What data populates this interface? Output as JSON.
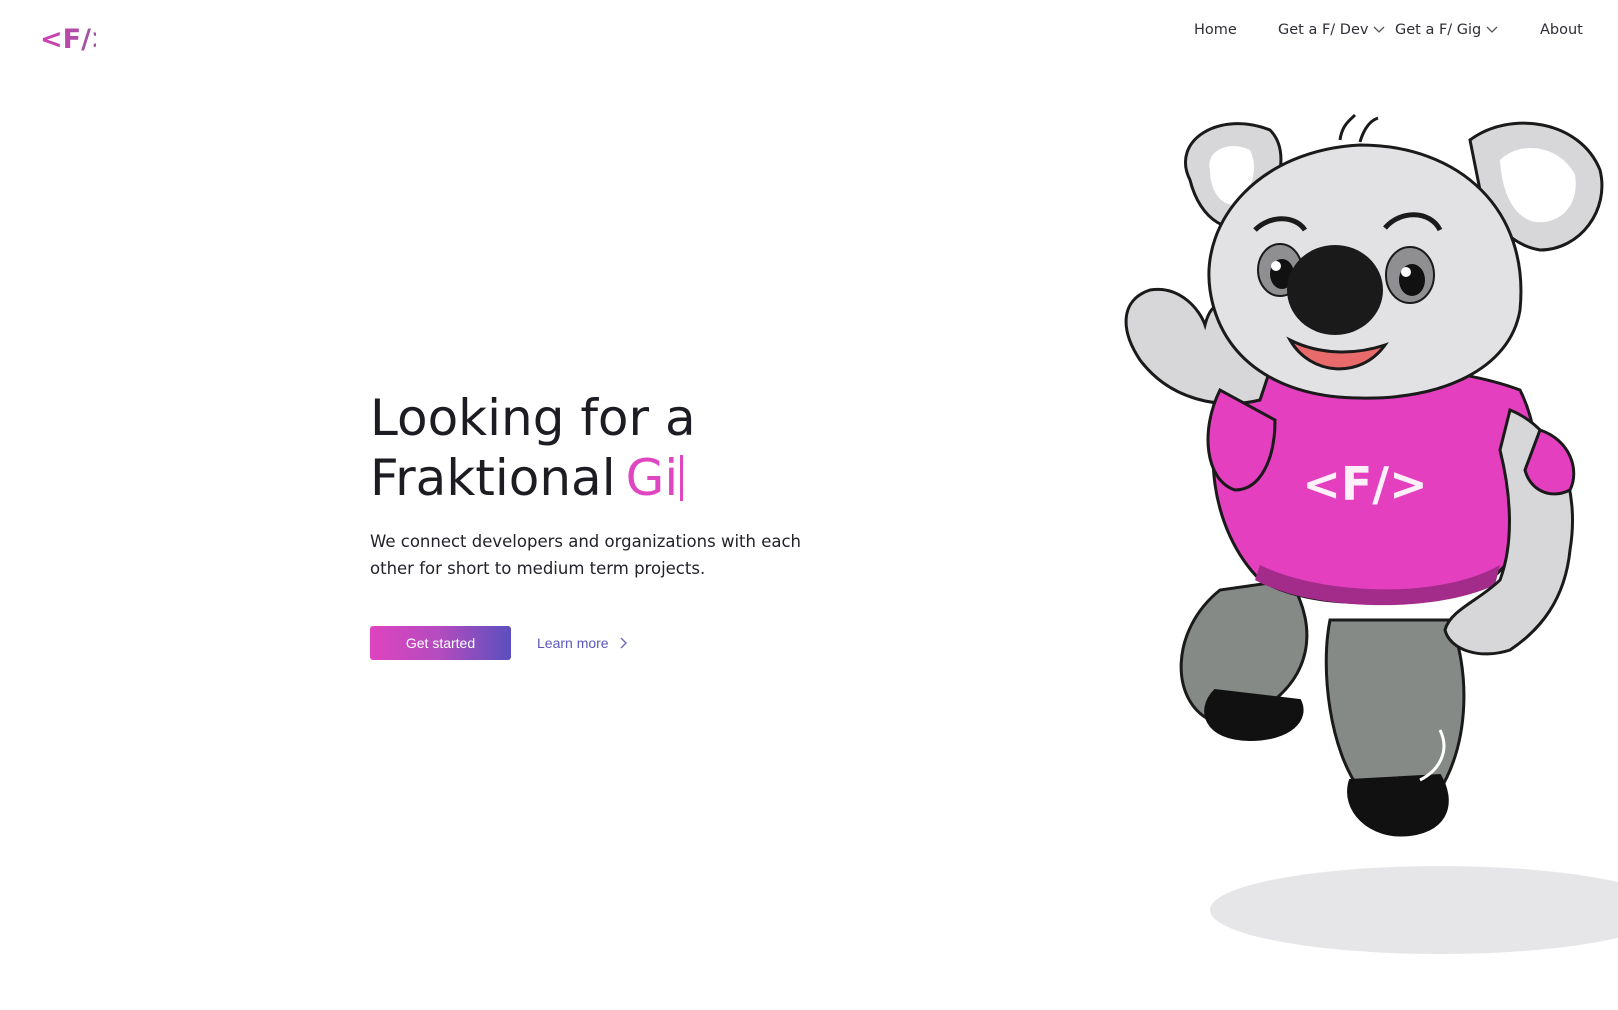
{
  "brand": {
    "logo_text": "<F/>",
    "primary_color": "#e046c1",
    "secondary_color": "#5b4fbd"
  },
  "nav": {
    "items": [
      {
        "label": "Home",
        "has_dropdown": false
      },
      {
        "label": "Get a F/ Dev",
        "has_dropdown": true
      },
      {
        "label": "Get a F/ Gig",
        "has_dropdown": true
      },
      {
        "label": "About",
        "has_dropdown": false
      }
    ]
  },
  "hero": {
    "headline_line1": "Looking for a",
    "headline_line2": "Fraktional",
    "typed_word": "Gi",
    "subtitle": "We connect developers and organizations with each other for short to medium term projects.",
    "primary_cta": "Get started",
    "secondary_cta": "Learn more"
  },
  "mascot": {
    "shirt_text": "<F/>",
    "shirt_color": "#e33fbf",
    "pants_color": "#858a87"
  }
}
